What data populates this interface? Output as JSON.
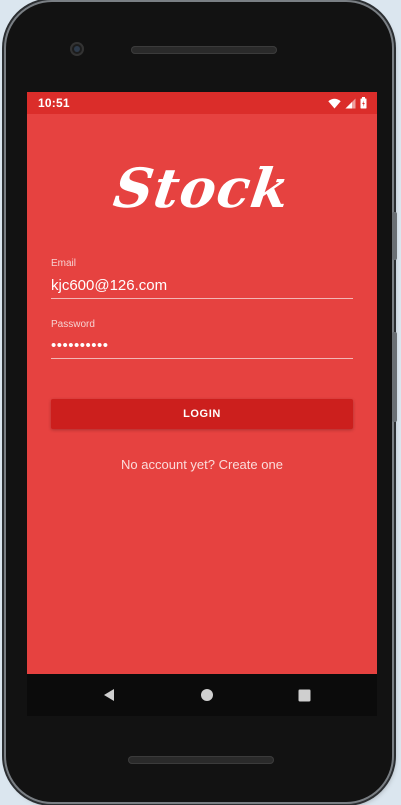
{
  "status_bar": {
    "time": "10:51",
    "icons": [
      "wifi-icon",
      "signal-icon",
      "battery-icon"
    ]
  },
  "app": {
    "logo_text": "Stock"
  },
  "login_form": {
    "email_label": "Email",
    "email_value": "kjc600@126.com",
    "password_label": "Password",
    "password_value": "••••••••••",
    "login_button_label": "LOGIN",
    "signup_link_text": "No account yet? Create one"
  },
  "navigation": {
    "buttons": [
      "back-icon",
      "home-icon",
      "recents-icon"
    ]
  },
  "colors": {
    "screen_background": "#e64240",
    "status_bar": "#db2d2a",
    "login_button": "#cc1f1d",
    "device_frame": "#121212"
  }
}
